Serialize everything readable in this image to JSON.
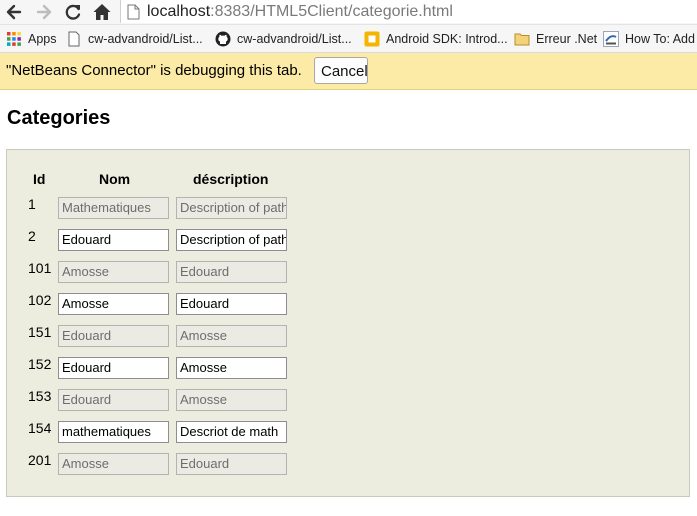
{
  "browser": {
    "url_host": "localhost",
    "url_rest": ":8383/HTML5Client/categorie.html",
    "bookmarks": [
      {
        "icon": "apps-grid-icon",
        "label": "Apps"
      },
      {
        "icon": "page-icon",
        "label": "cw-advandroid/List..."
      },
      {
        "icon": "github-icon",
        "label": "cw-advandroid/List..."
      },
      {
        "icon": "android-sdk-icon",
        "label": "Android SDK: Introd..."
      },
      {
        "icon": "folder-icon",
        "label": "Erreur .Net"
      },
      {
        "icon": "aspnet-icon",
        "label": "How To: Add"
      }
    ]
  },
  "infobar": {
    "message": "\"NetBeans Connector\" is debugging this tab.",
    "cancel_label": "Cancel"
  },
  "page": {
    "title": "Categories",
    "headers": {
      "id": "Id",
      "nom": "Nom",
      "description": "déscription"
    },
    "rows": [
      {
        "id": "1",
        "nom": "Mathematiques",
        "description": "Description of path",
        "editable": false
      },
      {
        "id": "2",
        "nom": "Edouard",
        "description": "Description of path",
        "editable": true
      },
      {
        "id": "101",
        "nom": "Amosse",
        "description": "Edouard",
        "editable": false
      },
      {
        "id": "102",
        "nom": "Amosse",
        "description": "Edouard",
        "editable": true
      },
      {
        "id": "151",
        "nom": "Edouard",
        "description": "Amosse",
        "editable": false
      },
      {
        "id": "152",
        "nom": "Edouard",
        "description": "Amosse",
        "editable": true
      },
      {
        "id": "153",
        "nom": "Edouard",
        "description": "Amosse",
        "editable": false
      },
      {
        "id": "154",
        "nom": "mathematiques",
        "description": "Descriot de math",
        "editable": true
      },
      {
        "id": "201",
        "nom": "Amosse",
        "description": "Edouard",
        "editable": false
      }
    ]
  }
}
